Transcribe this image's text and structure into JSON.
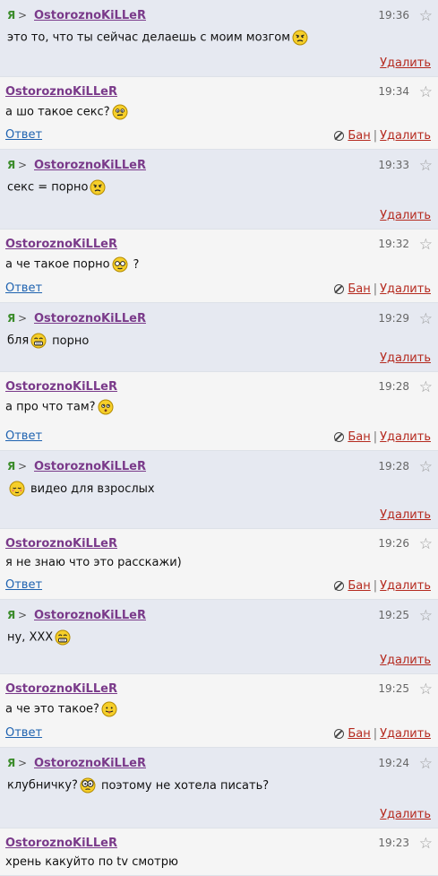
{
  "labels": {
    "me": "Я",
    "arrow": ">",
    "reply": "Ответ",
    "ban": "Бан",
    "sep": "|",
    "delete": "Удалить",
    "star": "☆"
  },
  "messages": [
    {
      "dir": "out",
      "author": "OstoroznoKiLLeR",
      "time": "19:36",
      "text_before": "это то, что ты сейчас делаешь с моим мозгом",
      "smiley": "angry-smiley-icon",
      "text_after": ""
    },
    {
      "dir": "in",
      "author": "OstoroznoKiLLeR",
      "time": "19:34",
      "text_before": "а шо такое секс?",
      "smiley": "confused-smiley-icon",
      "text_after": ""
    },
    {
      "dir": "out",
      "author": "OstoroznoKiLLeR",
      "time": "19:33",
      "text_before": "секс = порно",
      "smiley": "angry-smiley-icon",
      "text_after": ""
    },
    {
      "dir": "in",
      "author": "OstoroznoKiLLeR",
      "time": "19:32",
      "text_before": "а че такое порно",
      "smiley": "glasses-smiley-icon",
      "text_after": "?"
    },
    {
      "dir": "out",
      "author": "OstoroznoKiLLeR",
      "time": "19:29",
      "text_before": "бля",
      "smiley": "grin-smiley-icon",
      "text_after": "порно"
    },
    {
      "dir": "in",
      "author": "OstoroznoKiLLeR",
      "time": "19:28",
      "text_before": "а про что там?",
      "smiley": "wondering-smiley-icon",
      "text_after": ""
    },
    {
      "dir": "out",
      "author": "OstoroznoKiLLeR",
      "time": "19:28",
      "text_before": "",
      "smiley": "shy-smiley-icon",
      "text_after": "видео для взрослых"
    },
    {
      "dir": "in",
      "author": "OstoroznoKiLLeR",
      "time": "19:26",
      "text_before": "я не знаю что это расскажи)",
      "smiley": "",
      "text_after": ""
    },
    {
      "dir": "out",
      "author": "OstoroznoKiLLeR",
      "time": "19:25",
      "text_before": "ну, XXX",
      "smiley": "grin-smiley-icon",
      "text_after": ""
    },
    {
      "dir": "in",
      "author": "OstoroznoKiLLeR",
      "time": "19:25",
      "text_before": "а че это такое?",
      "smiley": "tongue-smiley-icon",
      "text_after": ""
    },
    {
      "dir": "out",
      "author": "OstoroznoKiLLeR",
      "time": "19:24",
      "text_before": "клубничку?",
      "smiley": "big-eyes-smiley-icon",
      "text_after": "поэтому не хотела писать?"
    },
    {
      "dir": "in",
      "author": "OstoroznoKiLLeR",
      "time": "19:23",
      "text_before": "хрень какуйто по tv смотрю",
      "smiley": "",
      "text_after": ""
    }
  ]
}
